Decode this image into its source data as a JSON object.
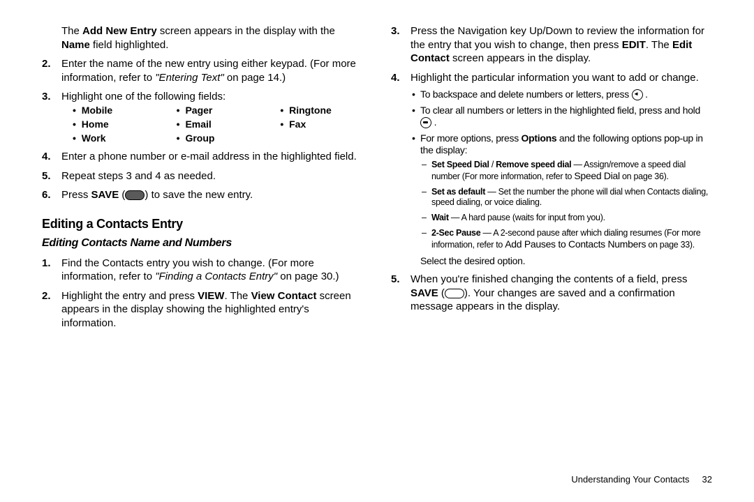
{
  "left": {
    "intro": {
      "pre": "The ",
      "b1": "Add New Entry",
      "mid": " screen appears in the display with the ",
      "b2": "Name",
      "post": " field highlighted."
    },
    "items": {
      "s2": {
        "n": "2.",
        "a": "Enter the name of the new entry using either keypad. (For more information, refer to ",
        "i": "\"Entering Text\"",
        "b": "  on page 14.)"
      },
      "s3": {
        "n": "3.",
        "a": "Highlight one of the following fields:"
      },
      "s4": {
        "n": "4.",
        "a": "Enter a phone number or e-mail address in the highlighted field."
      },
      "s5": {
        "n": "5.",
        "a": "Repeat steps 3 and 4 as needed."
      },
      "s6": {
        "n": "6.",
        "a": "Press ",
        "b": "SAVE",
        "c": " (",
        "d": ") to save the new entry."
      }
    },
    "fields": [
      "Mobile",
      "Pager",
      "Ringtone",
      "Home",
      "Email",
      "Fax",
      "Work",
      "Group"
    ],
    "h_section": "Editing a Contacts Entry",
    "h_sub": "Editing Contacts Name and Numbers",
    "edit": {
      "e1": {
        "n": "1.",
        "a": "Find the Contacts entry you wish to change. (For more information, refer to ",
        "i": "\"Finding a Contacts Entry\"",
        "b": "  on page 30.)"
      },
      "e2": {
        "n": "2.",
        "a": "Highlight the entry and press ",
        "b1": "VIEW",
        "c": ". The ",
        "b2": "View Contact",
        "d": " screen appears in the display showing the highlighted entry's information."
      }
    }
  },
  "right": {
    "items": {
      "s3": {
        "n": "3.",
        "a": "Press the Navigation key Up/Down to review the information for the entry that you wish to change, then press ",
        "b1": "EDIT",
        "c": ". The ",
        "b2": "Edit Contact",
        "d": " screen appears in the display."
      },
      "s4": {
        "n": "4.",
        "a": "Highlight the particular information you want to add or change."
      },
      "s5": {
        "n": "5.",
        "a": "When you're finished changing the contents of a field, press ",
        "b": "SAVE",
        "c": " (",
        "d": "). Your changes are saved and a confirmation message appears in the display."
      }
    },
    "bullets": {
      "b1": {
        "a": "To backspace and delete numbers or letters, press ",
        "b": " ."
      },
      "b2": {
        "a": "To clear all numbers or letters in the highlighted field, press and hold ",
        "b": " ."
      },
      "b3": {
        "a": "For more options, press ",
        "b": "Options",
        "c": " and the following options pop-up in the display:"
      }
    },
    "dashes": {
      "d1": {
        "b1": "Set Speed Dial",
        "s": " / ",
        "b2": "Remove speed dial",
        "a": " — Assign/remove a speed dial number (For more information, refer to  ",
        "ref": "Speed Dial",
        "po": " on page 36)."
      },
      "d2": {
        "b": "Set as default",
        "a": " — Set the number the phone will dial when Contacts dialing, speed dialing, or voice dialing."
      },
      "d3": {
        "b": "Wait",
        "a": " — A hard pause (waits for input from you)."
      },
      "d4": {
        "b": "2-Sec Pause",
        "a": " — A 2-second pause after which dialing resumes (For more information, refer to  ",
        "ref": "Add Pauses to Contacts Numbers",
        "po": "  on page 33)."
      }
    },
    "select": "Select the desired option."
  },
  "footer": {
    "label": "Understanding Your Contacts",
    "page": "32"
  }
}
